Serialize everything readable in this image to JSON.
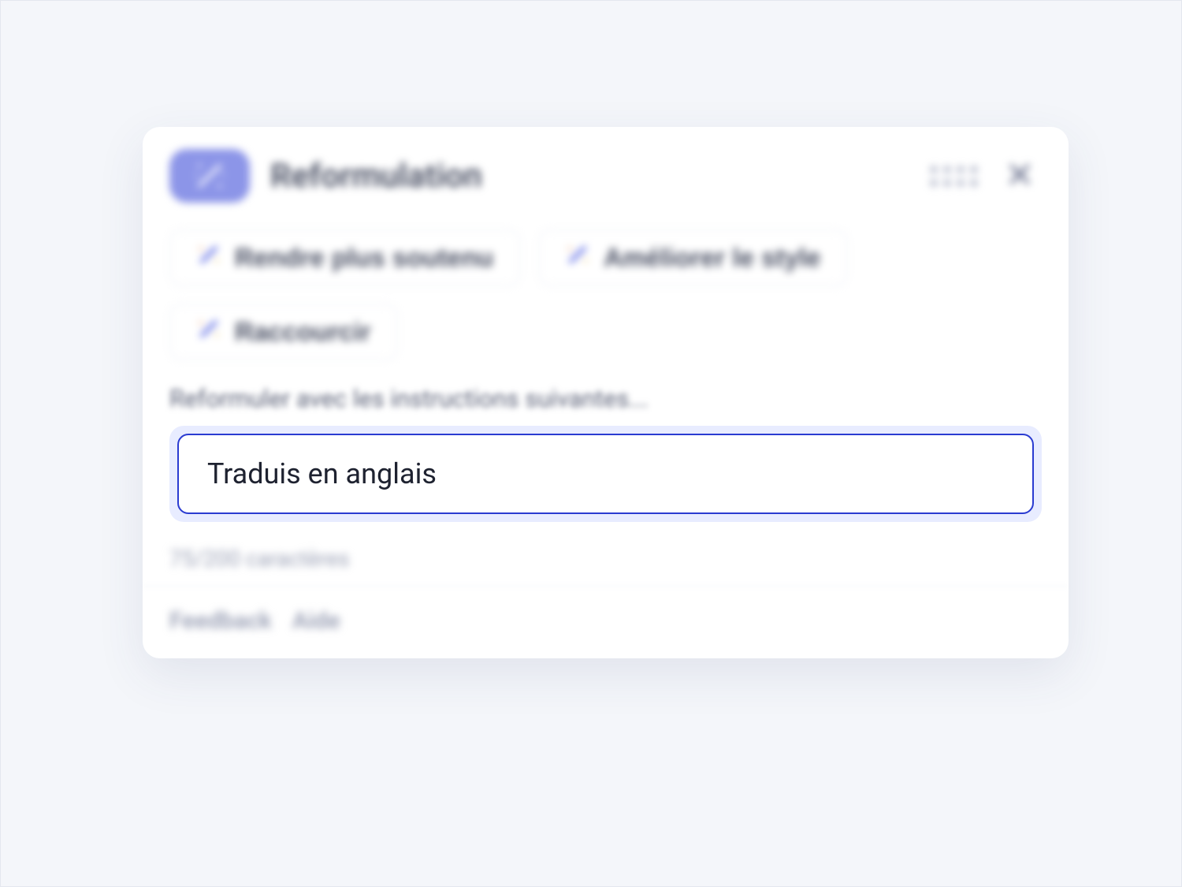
{
  "header": {
    "title": "Reformulation"
  },
  "chips": [
    {
      "label": "Rendre plus soutenu"
    },
    {
      "label": "Améliorer le style"
    },
    {
      "label": "Raccourcir"
    }
  ],
  "prompt": {
    "label": "Reformuler avec les instructions suivantes...",
    "value": "Traduis en anglais",
    "char_count": "75/200 caractères"
  },
  "footer": {
    "feedback": "Feedback",
    "help": "Aide"
  }
}
